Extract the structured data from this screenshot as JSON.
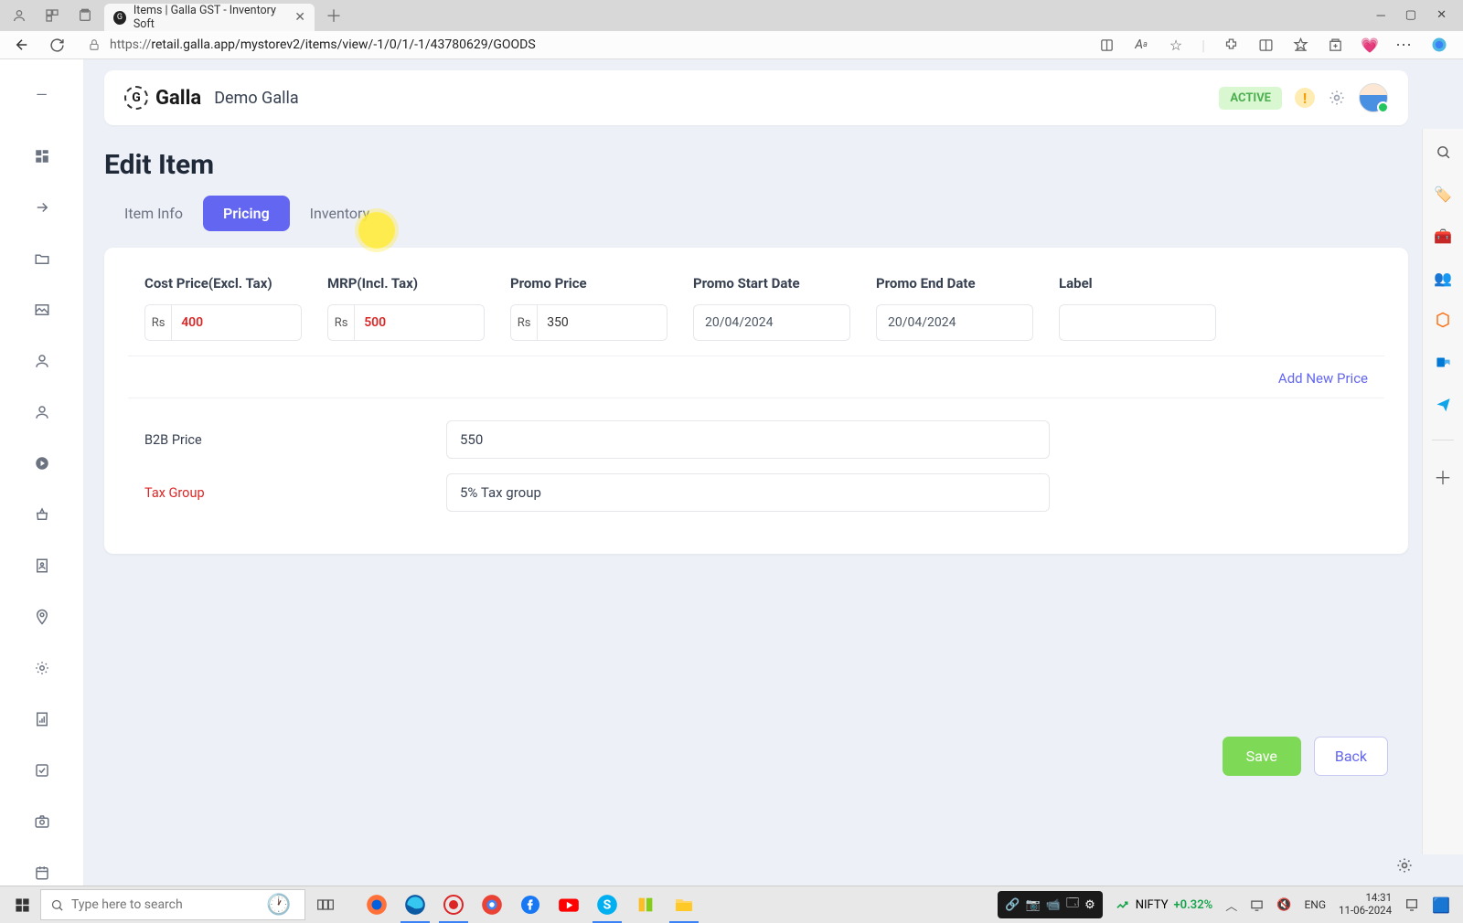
{
  "browser": {
    "tab_title": "Items | Galla GST - Inventory Soft",
    "url_display": "retail.galla.app/mystorev2/items/view/-1/0/1/-1/43780629/GOODS",
    "url_prefix": "https://"
  },
  "header": {
    "logo_text": "Galla",
    "store_name": "Demo Galla",
    "status": "ACTIVE",
    "notification_icon": "!"
  },
  "page": {
    "title": "Edit Item",
    "tabs": {
      "item_info": "Item Info",
      "pricing": "Pricing",
      "inventory": "Inventory"
    }
  },
  "pricing": {
    "headers": {
      "cost": "Cost Price(Excl. Tax)",
      "mrp": "MRP(Incl. Tax)",
      "promo": "Promo Price",
      "start": "Promo Start Date",
      "end": "Promo End Date",
      "label": "Label"
    },
    "currency": "Rs",
    "row": {
      "cost": "400",
      "mrp": "500",
      "promo": "350",
      "start": "20/04/2024",
      "end": "20/04/2024",
      "label": ""
    },
    "add_new": "Add New Price"
  },
  "extra": {
    "b2b_label": "B2B Price",
    "b2b_value": "550",
    "tax_label": "Tax Group",
    "tax_value": "5% Tax group"
  },
  "buttons": {
    "save": "Save",
    "back": "Back"
  },
  "taskbar": {
    "search_placeholder": "Type here to search",
    "stock_name": "NIFTY",
    "stock_change": "+0.32%",
    "lang": "ENG",
    "time": "14:31",
    "date": "11-06-2024"
  }
}
